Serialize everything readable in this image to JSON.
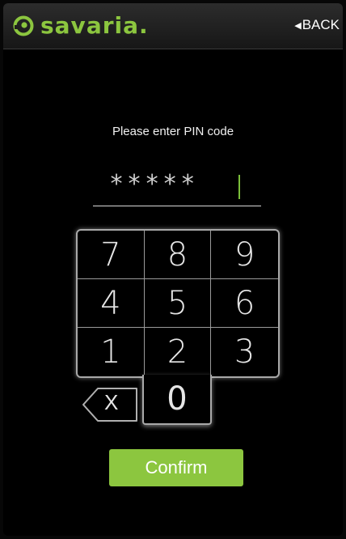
{
  "header": {
    "brand": "savaria.",
    "back_label": "BACK",
    "brand_color": "#8cc63f"
  },
  "pin": {
    "prompt": "Please enter PIN code",
    "value": "*****"
  },
  "keypad": {
    "keys": [
      "7",
      "8",
      "9",
      "4",
      "5",
      "6",
      "1",
      "2",
      "3"
    ],
    "zero": "0",
    "backspace_label": "X"
  },
  "confirm": {
    "label": "Confirm",
    "color": "#8cc63f"
  },
  "icons": {
    "logo": "savaria-logo-icon",
    "back": "back-arrow-icon",
    "backspace": "backspace-icon"
  }
}
